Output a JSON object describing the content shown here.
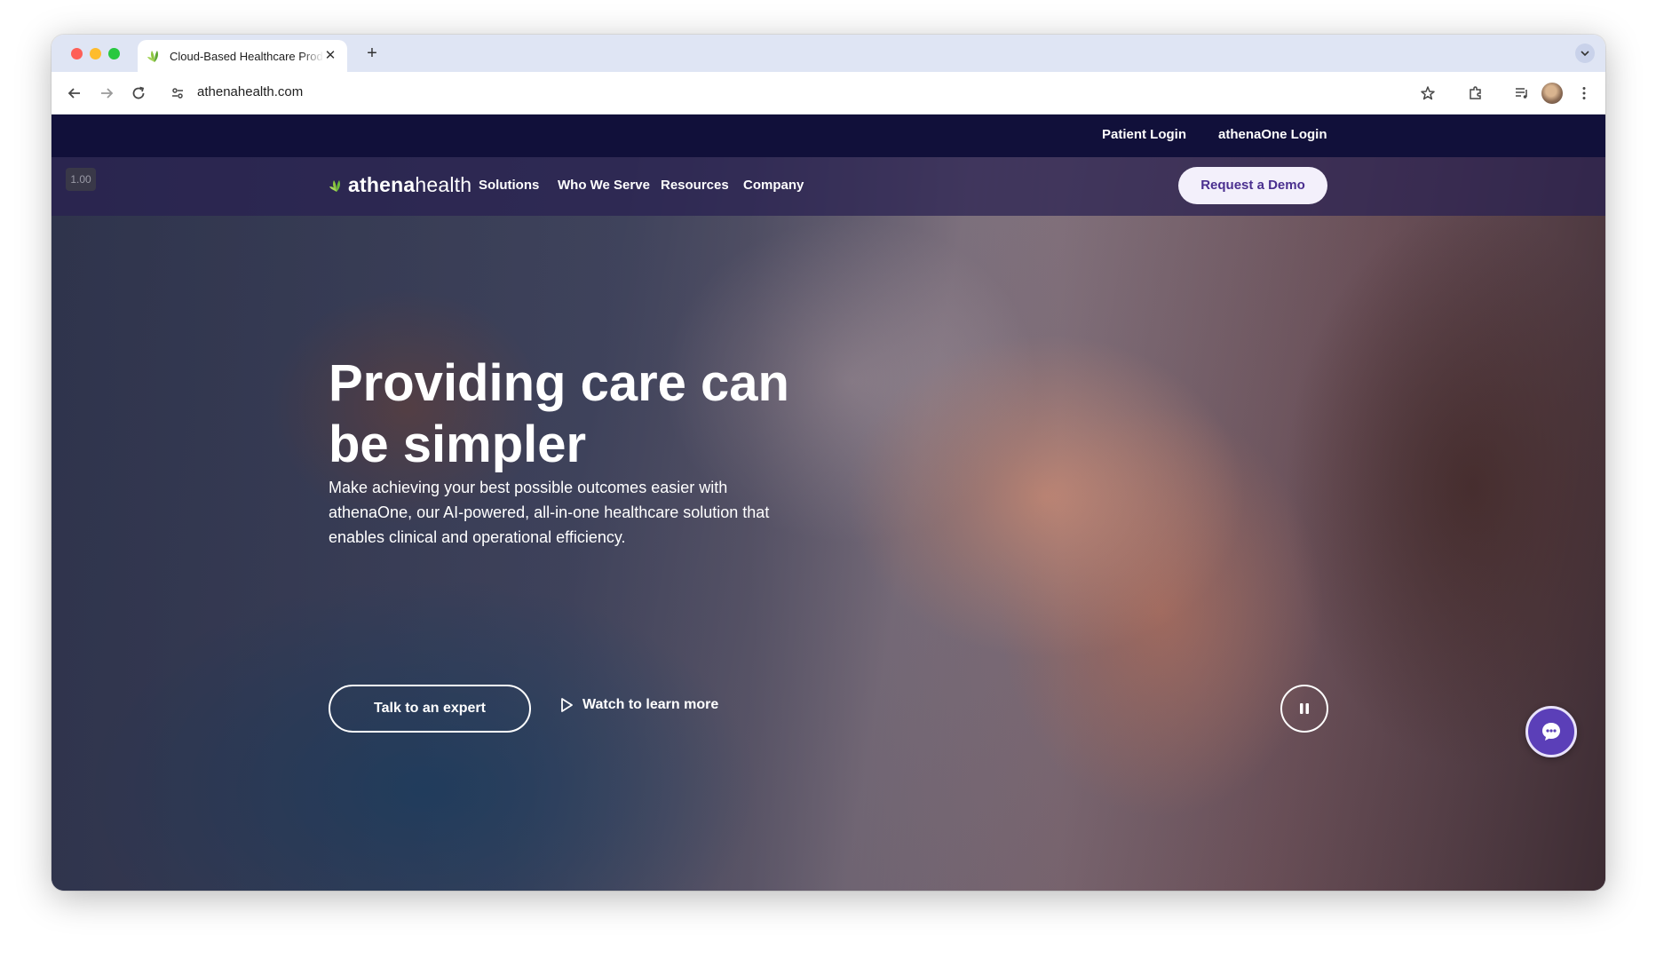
{
  "browser": {
    "tab_title": "Cloud-Based Healthcare Products",
    "url": "athenahealth.com"
  },
  "site": {
    "top_links": {
      "patient_login": "Patient Login",
      "athenaone_login": "athenaOne Login"
    },
    "speed_badge": "1.00",
    "logo": {
      "bold": "athena",
      "regular": "health"
    },
    "nav": {
      "solutions": "Solutions",
      "who_we_serve": "Who We Serve",
      "resources": "Resources",
      "company": "Company"
    },
    "demo_button": "Request a Demo",
    "hero": {
      "title": "Providing care can be simpler",
      "subtitle": "Make achieving your best possible outcomes easier with athenaOne, our AI-powered, all-in-one healthcare solution that enables clinical and operational efficiency.",
      "cta_primary": "Talk to an expert",
      "cta_secondary": "Watch to learn more"
    }
  },
  "icons": [
    "leaf-favicon-icon",
    "close-icon",
    "plus-icon",
    "back-arrow-icon",
    "forward-arrow-icon",
    "reload-icon",
    "site-info-icon",
    "star-icon",
    "extensions-icon",
    "media-queue-icon",
    "kebab-menu-icon",
    "chevron-down-icon",
    "play-icon",
    "pause-icon",
    "chat-icon"
  ],
  "colors": {
    "topbar": "#11103a",
    "demo_button_text": "#4a2f8f",
    "chat_button": "#5b3fb8",
    "logo_leaf": "#8cc63f"
  }
}
